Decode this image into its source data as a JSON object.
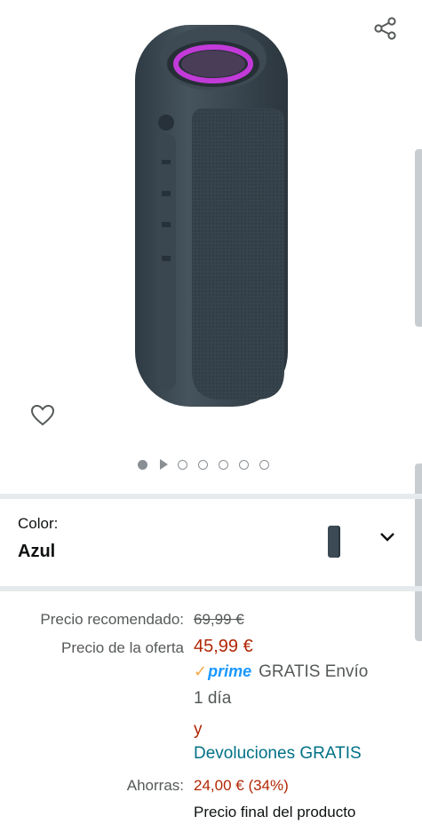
{
  "gallery": {
    "share_icon": "share-icon",
    "favorite_icon": "heart-icon",
    "image_alt": "Altavoz Bluetooth azul",
    "indicator_count": 7,
    "active_indicator": 0,
    "video_indicator": 1
  },
  "color_selector": {
    "label": "Color:",
    "value": "Azul",
    "swatch_color": "#3b4a54",
    "dropdown_icon": "chevron-down-icon"
  },
  "pricing": {
    "recommended_label": "Precio recomendado:",
    "recommended_value": "69,99 €",
    "offer_label": "Precio de la oferta",
    "offer_value": "45,99 €",
    "prime_check": "✓",
    "prime_word": "prime",
    "shipping_line1": "GRATIS Envío",
    "shipping_line2": "1 día",
    "and_text": "y",
    "returns_text": "Devoluciones GRATIS",
    "savings_label": "Ahorras:",
    "savings_value": "24,00 € (34%)",
    "final_price_note": "Precio final del producto"
  },
  "colors": {
    "price_red": "#b12704",
    "link_teal": "#007185",
    "prime_blue": "#1a98ff",
    "secondary_text": "#565959"
  }
}
